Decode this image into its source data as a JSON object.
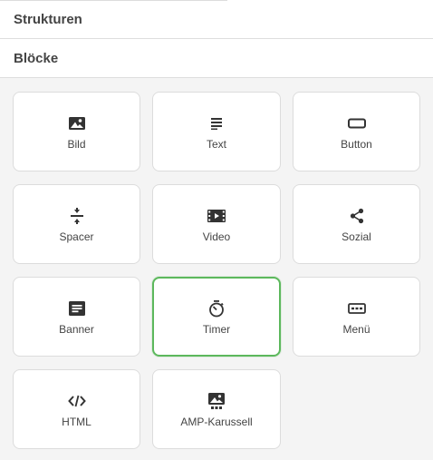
{
  "sections": {
    "structures_label": "Strukturen",
    "blocks_label": "Blöcke"
  },
  "accent_color": "#5cb85c",
  "blocks": [
    {
      "label": "Bild",
      "icon": "image-icon",
      "selected": false
    },
    {
      "label": "Text",
      "icon": "text-lines-icon",
      "selected": false
    },
    {
      "label": "Button",
      "icon": "button-rectangle-icon",
      "selected": false
    },
    {
      "label": "Spacer",
      "icon": "spacer-icon",
      "selected": false
    },
    {
      "label": "Video",
      "icon": "video-icon",
      "selected": false
    },
    {
      "label": "Sozial",
      "icon": "share-icon",
      "selected": false
    },
    {
      "label": "Banner",
      "icon": "banner-icon",
      "selected": false
    },
    {
      "label": "Timer",
      "icon": "timer-icon",
      "selected": true
    },
    {
      "label": "Menü",
      "icon": "menu-icon",
      "selected": false
    },
    {
      "label": "HTML",
      "icon": "code-icon",
      "selected": false
    },
    {
      "label": "AMP-Karussell",
      "icon": "carousel-icon",
      "selected": false
    }
  ]
}
